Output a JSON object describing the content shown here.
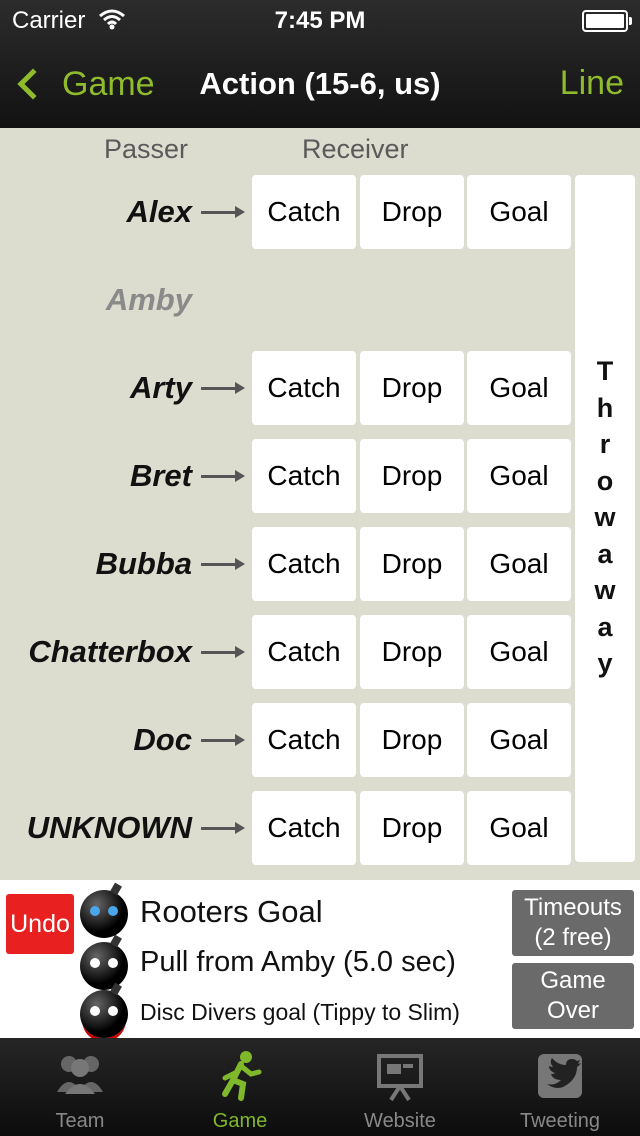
{
  "status_bar": {
    "carrier": "Carrier",
    "time": "7:45 PM"
  },
  "nav": {
    "back_label": "Game",
    "title": "Action (15-6, us)",
    "right_label": "Line"
  },
  "headers": {
    "passer": "Passer",
    "receiver": "Receiver"
  },
  "players": [
    {
      "name": "Alex",
      "active": true
    },
    {
      "name": "Amby",
      "active": false
    },
    {
      "name": "Arty",
      "active": true
    },
    {
      "name": "Bret",
      "active": true
    },
    {
      "name": "Bubba",
      "active": true
    },
    {
      "name": "Chatterbox",
      "active": true
    },
    {
      "name": "Doc",
      "active": true
    },
    {
      "name": "UNKNOWN",
      "active": true
    }
  ],
  "actions": {
    "catch": "Catch",
    "drop": "Drop",
    "goal": "Goal"
  },
  "throwaway": "Throwaway",
  "log": {
    "undo": "Undo",
    "events": [
      "Rooters Goal",
      "Pull from Amby (5.0 sec)",
      "Disc Divers goal (Tippy to Slim)"
    ],
    "timeouts": "Timeouts (2 free)",
    "game_over": "Game Over"
  },
  "tabs": [
    {
      "label": "Team",
      "icon": "team-icon",
      "active": false
    },
    {
      "label": "Game",
      "icon": "runner-icon",
      "active": true
    },
    {
      "label": "Website",
      "icon": "presentation-icon",
      "active": false
    },
    {
      "label": "Tweeting",
      "icon": "twitter-icon",
      "active": false
    }
  ],
  "colors": {
    "accent": "#8fbc2c",
    "undo": "#e8201f",
    "background": "#dcdccf"
  }
}
